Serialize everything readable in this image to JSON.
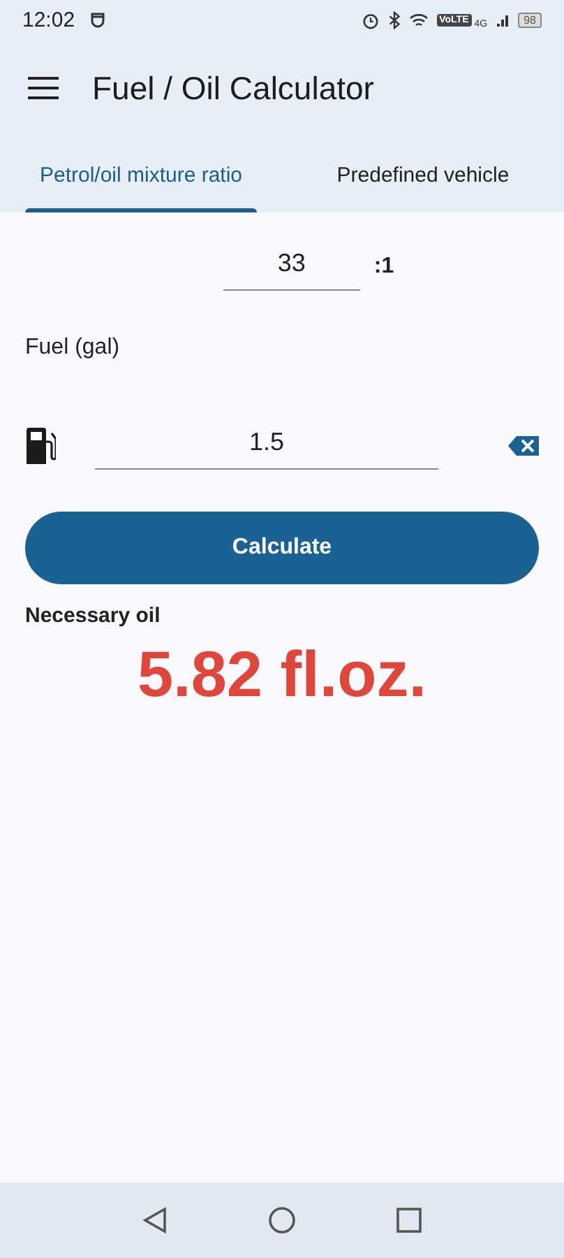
{
  "status_bar": {
    "time": "12:02",
    "network_badge": "VoLTE",
    "network_type": "4G",
    "battery": "98"
  },
  "app_bar": {
    "title": "Fuel / Oil Calculator"
  },
  "tabs": [
    {
      "label": "Petrol/oil mixture ratio",
      "selected": true
    },
    {
      "label": "Predefined vehicle",
      "selected": false
    }
  ],
  "ratio": {
    "value": "33",
    "suffix": ":1"
  },
  "fuel": {
    "label": "Fuel (gal)",
    "value": "1.5"
  },
  "calculate_button": "Calculate",
  "result": {
    "label": "Necessary oil",
    "value": "5.82 fl.oz."
  }
}
